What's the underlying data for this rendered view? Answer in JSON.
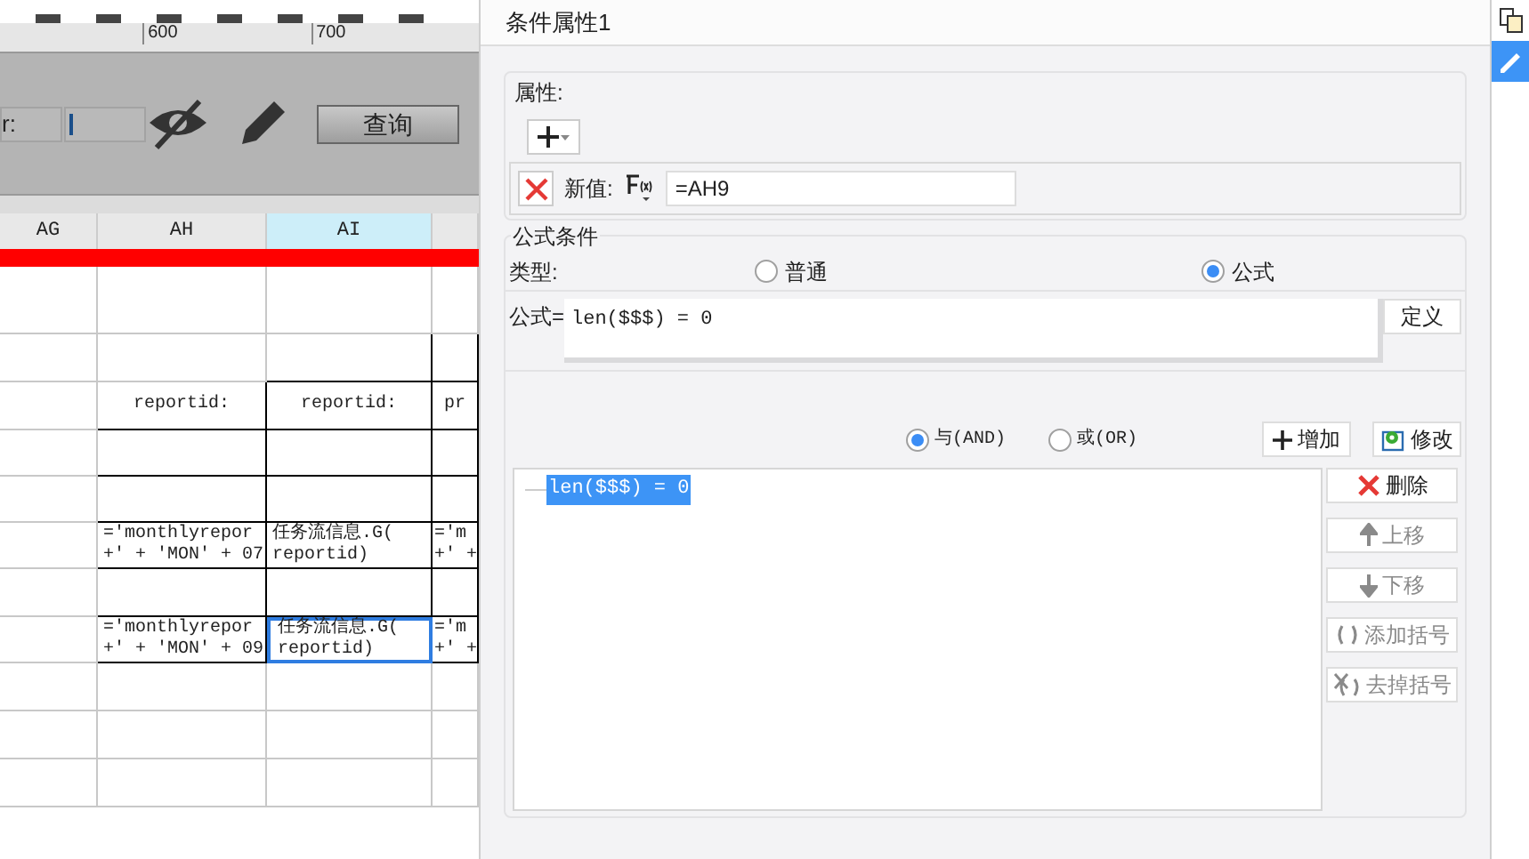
{
  "ruler": {
    "ticks": [
      "600",
      "700"
    ]
  },
  "parameter_panel": {
    "label": "r:",
    "query_button": "查询"
  },
  "sheet": {
    "columns": [
      {
        "label": "AG",
        "selected": false
      },
      {
        "label": "AH",
        "selected": false
      },
      {
        "label": "AI",
        "selected": true
      },
      {
        "selected": false
      }
    ],
    "rows": [
      {
        "kind": "blank"
      },
      {
        "kind": "boxed"
      },
      {
        "kind": "text",
        "cells": [
          {
            "selected": false
          },
          {
            "lines": [
              "reportid:"
            ],
            "selected": false
          },
          {
            "lines": [
              "reportid:"
            ],
            "selected": false
          },
          {
            "lines": [
              "pr"
            ],
            "selected": false
          }
        ]
      },
      {
        "kind": "boxed"
      },
      {
        "kind": "boxed"
      },
      {
        "kind": "formula",
        "cells": [
          {
            "selected": false
          },
          {
            "lines": [
              "='monthlyrepor",
              "+' + 'MON' + 07"
            ],
            "selected": false
          },
          {
            "lines": [
              "任务流信息.G(",
              "reportid)"
            ],
            "selected": false
          },
          {
            "lines": [
              "='m",
              "+' +"
            ],
            "selected": false
          }
        ]
      },
      {
        "kind": "boxed"
      },
      {
        "kind": "formula",
        "cells": [
          {
            "selected": false
          },
          {
            "lines": [
              "='monthlyrepor",
              "+' + 'MON' + 09"
            ],
            "selected": false
          },
          {
            "lines": [
              "任务流信息.G(",
              "reportid)"
            ],
            "selected": true
          },
          {
            "lines": [
              "='m",
              "+' +"
            ],
            "selected": false
          }
        ]
      },
      {
        "kind": "blank"
      },
      {
        "kind": "blank"
      },
      {
        "kind": "blank"
      }
    ]
  },
  "panel": {
    "title": "条件属性1",
    "attributes": {
      "legend": "属性:",
      "new_value_label": "新值:",
      "new_value": "=AH9"
    },
    "formula_condition": {
      "legend": "公式条件",
      "type_label": "类型:",
      "types": [
        {
          "label": "普通",
          "selected": false
        },
        {
          "label": "公式",
          "selected": true
        }
      ],
      "formula_label": "公式=",
      "formula": "len($$$) = 0",
      "define_button": "定义",
      "joins": [
        {
          "label": "与(AND)",
          "selected": true
        },
        {
          "label": "或(OR)",
          "selected": false
        }
      ],
      "add_button": "增加",
      "modify_button": "修改",
      "conditions": [
        {
          "label": "len($$$) = 0",
          "selected": true
        }
      ],
      "side_buttons": [
        {
          "kind": "delete",
          "label": "删除",
          "disabled": false
        },
        {
          "kind": "up",
          "label": "上移",
          "disabled": true
        },
        {
          "kind": "down",
          "label": "下移",
          "disabled": true
        },
        {
          "kind": "add-paren",
          "label": "添加括号",
          "disabled": true
        },
        {
          "kind": "remove-paren",
          "label": "去掉括号",
          "disabled": true
        }
      ]
    }
  },
  "side_tabs": [
    {
      "kind": "copy",
      "selected": false
    },
    {
      "kind": "edit",
      "selected": true
    }
  ]
}
